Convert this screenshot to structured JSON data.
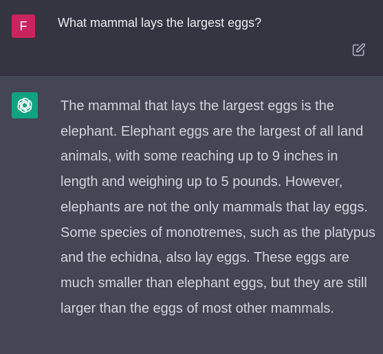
{
  "user": {
    "avatar_letter": "F",
    "message": "What mammal lays the largest eggs?"
  },
  "assistant": {
    "message": "The mammal that lays the largest eggs is the elephant. Elephant eggs are the largest of all land animals, with some reaching up to 9 inches in length and weighing up to 5 pounds. However, elephants are not the only mammals that lay eggs. Some species of monotremes, such as the platypus and the echidna, also lay eggs. These eggs are much smaller than elephant eggs, but they are still larger than the eggs of most other mammals."
  },
  "icons": {
    "edit": "edit-icon",
    "assistant_logo": "openai-logo-icon"
  },
  "colors": {
    "user_bg": "#343541",
    "assistant_bg": "#444654",
    "user_avatar": "#c9245d",
    "assistant_avatar": "#10a37f"
  }
}
